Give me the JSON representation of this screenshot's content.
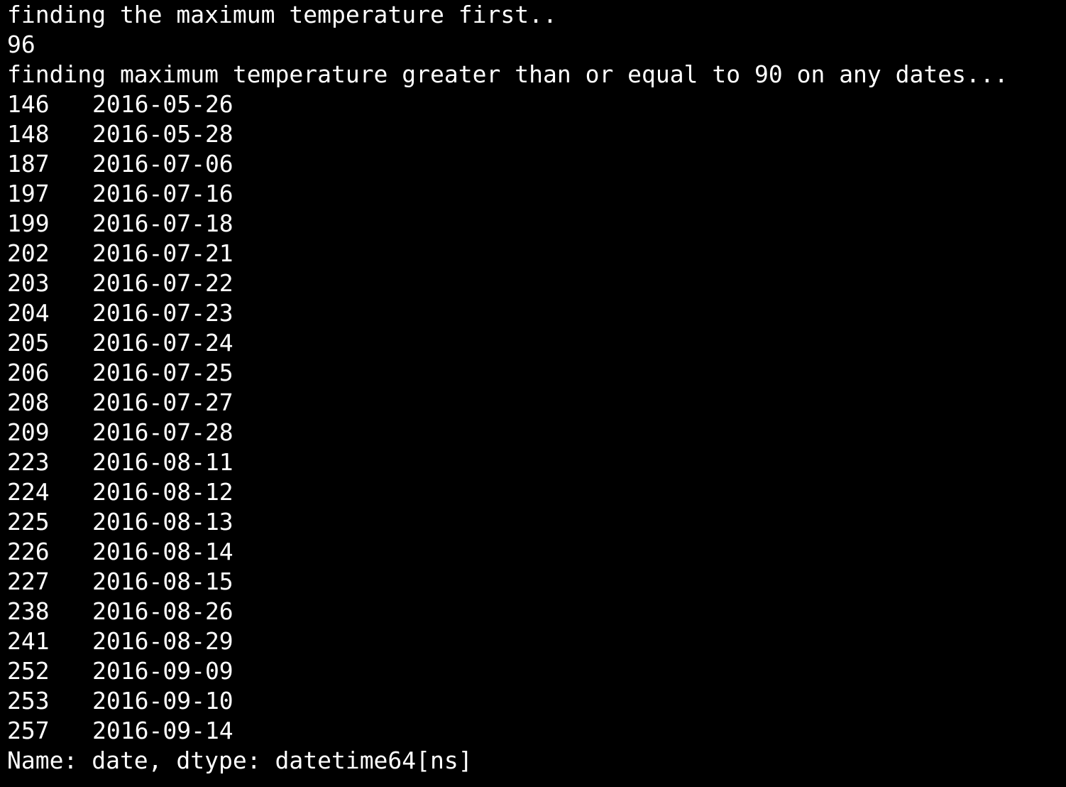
{
  "terminal": {
    "background": "#000000",
    "foreground": "#ffffff",
    "line1": "finding the maximum temperature first..",
    "max_value": "96",
    "line3": "finding maximum temperature greater than or equal to 90 on any dates...",
    "rows": [
      {
        "index": "146",
        "date": "2016-05-26"
      },
      {
        "index": "148",
        "date": "2016-05-28"
      },
      {
        "index": "187",
        "date": "2016-07-06"
      },
      {
        "index": "197",
        "date": "2016-07-16"
      },
      {
        "index": "199",
        "date": "2016-07-18"
      },
      {
        "index": "202",
        "date": "2016-07-21"
      },
      {
        "index": "203",
        "date": "2016-07-22"
      },
      {
        "index": "204",
        "date": "2016-07-23"
      },
      {
        "index": "205",
        "date": "2016-07-24"
      },
      {
        "index": "206",
        "date": "2016-07-25"
      },
      {
        "index": "208",
        "date": "2016-07-27"
      },
      {
        "index": "209",
        "date": "2016-07-28"
      },
      {
        "index": "223",
        "date": "2016-08-11"
      },
      {
        "index": "224",
        "date": "2016-08-12"
      },
      {
        "index": "225",
        "date": "2016-08-13"
      },
      {
        "index": "226",
        "date": "2016-08-14"
      },
      {
        "index": "227",
        "date": "2016-08-15"
      },
      {
        "index": "238",
        "date": "2016-08-26"
      },
      {
        "index": "241",
        "date": "2016-08-29"
      },
      {
        "index": "252",
        "date": "2016-09-09"
      },
      {
        "index": "253",
        "date": "2016-09-10"
      },
      {
        "index": "257",
        "date": "2016-09-14"
      }
    ],
    "footer": "Name: date, dtype: datetime64[ns]"
  }
}
